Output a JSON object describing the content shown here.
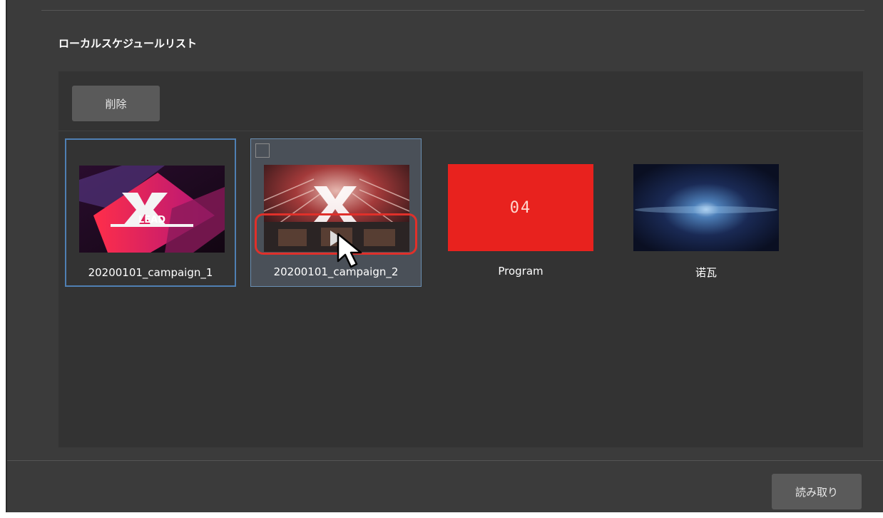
{
  "section": {
    "title": "ローカルスケジュールリスト"
  },
  "toolbar": {
    "delete_label": "削除"
  },
  "items": [
    {
      "name": "20200101_campaign_1",
      "thumb_text": "LEAD",
      "selected": true
    },
    {
      "name": "20200101_campaign_2",
      "selected": true,
      "checkbox_checked": false
    },
    {
      "name": "Program",
      "thumb_text": "04",
      "thumb_color": "#e8221e"
    },
    {
      "name": "诺瓦"
    }
  ],
  "footer": {
    "read_label": "読み取り"
  },
  "colors": {
    "panel_bg": "#3b3b3b",
    "list_bg": "#333333",
    "button_bg": "#5a5a5a",
    "selection_border": "#4f7fb3",
    "highlight_red": "#e0302a"
  }
}
